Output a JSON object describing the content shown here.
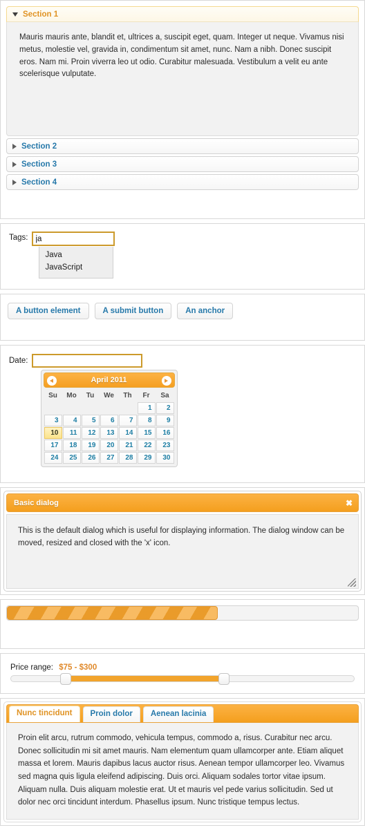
{
  "accordion": {
    "sections": [
      {
        "label": "Section 1",
        "expanded": true,
        "content": "Mauris mauris ante, blandit et, ultrices a, suscipit eget, quam. Integer ut neque. Vivamus nisi metus, molestie vel, gravida in, condimentum sit amet, nunc. Nam a nibh. Donec suscipit eros. Nam mi. Proin viverra leo ut odio. Curabitur malesuada. Vestibulum a velit eu ante scelerisque vulputate."
      },
      {
        "label": "Section 2",
        "expanded": false
      },
      {
        "label": "Section 3",
        "expanded": false
      },
      {
        "label": "Section 4",
        "expanded": false
      }
    ]
  },
  "autocomplete": {
    "label": "Tags:",
    "value": "ja",
    "placeholder": "",
    "suggestions": [
      {
        "label": "Java"
      },
      {
        "label": "JavaScript"
      }
    ]
  },
  "buttons": {
    "items": [
      {
        "label": "A button element"
      },
      {
        "label": "A submit button"
      },
      {
        "label": "An anchor"
      }
    ]
  },
  "datepicker": {
    "label": "Date:",
    "value": "",
    "placeholder": "",
    "month_title": "April 2011",
    "prev_title": "Prev",
    "next_title": "Next",
    "weekdays": [
      "Su",
      "Mo",
      "Tu",
      "We",
      "Th",
      "Fr",
      "Sa"
    ],
    "weeks": [
      [
        "",
        "",
        "",
        "",
        "",
        "1",
        "2"
      ],
      [
        "3",
        "4",
        "5",
        "6",
        "7",
        "8",
        "9"
      ],
      [
        "10",
        "11",
        "12",
        "13",
        "14",
        "15",
        "16"
      ],
      [
        "17",
        "18",
        "19",
        "20",
        "21",
        "22",
        "23"
      ],
      [
        "24",
        "25",
        "26",
        "27",
        "28",
        "29",
        "30"
      ]
    ],
    "today": "10"
  },
  "dialog": {
    "title": "Basic dialog",
    "close_label": "✖",
    "body": "This is the default dialog which is useful for displaying information. The dialog window can be moved, resized and closed with the 'x' icon."
  },
  "progressbar": {
    "value_percent": 60
  },
  "slider": {
    "label": "Price range:",
    "amount": "$75 - $300",
    "min_percent": 16,
    "max_percent": 62
  },
  "tabs": {
    "items": [
      {
        "label": "Nunc tincidunt",
        "active": true
      },
      {
        "label": "Proin dolor",
        "active": false
      },
      {
        "label": "Aenean lacinia",
        "active": false
      }
    ],
    "panel_text": "Proin elit arcu, rutrum commodo, vehicula tempus, commodo a, risus. Curabitur nec arcu. Donec sollicitudin mi sit amet mauris. Nam elementum quam ullamcorper ante. Etiam aliquet massa et lorem. Mauris dapibus lacus auctor risus. Aenean tempor ullamcorper leo. Vivamus sed magna quis ligula eleifend adipiscing. Duis orci. Aliquam sodales tortor vitae ipsum. Aliquam nulla. Duis aliquam molestie erat. Ut et mauris vel pede varius sollicitudin. Sed ut dolor nec orci tincidunt interdum. Phasellus ipsum. Nunc tristique tempus lectus."
  },
  "colors": {
    "accent_orange": "#f2a42c",
    "link_blue": "#2779aa",
    "active_text": "#e09324",
    "panel_bg": "#f2f2f2"
  }
}
